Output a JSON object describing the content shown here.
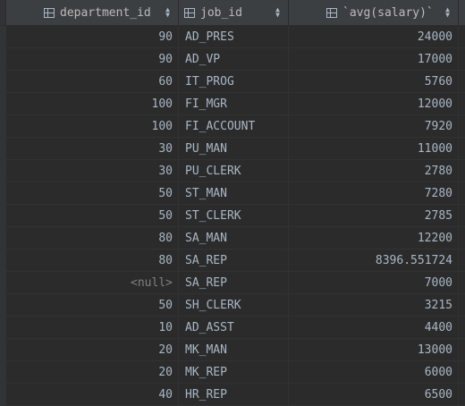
{
  "table": {
    "columns": [
      {
        "label": "department_id",
        "icon": "column-icon"
      },
      {
        "label": "job_id",
        "icon": "column-icon"
      },
      {
        "label": "`avg(salary)`",
        "icon": "column-icon"
      }
    ],
    "rows": [
      {
        "department_id": "90",
        "job_id": "AD_PRES",
        "avg_salary": "24000"
      },
      {
        "department_id": "90",
        "job_id": "AD_VP",
        "avg_salary": "17000"
      },
      {
        "department_id": "60",
        "job_id": "IT_PROG",
        "avg_salary": "5760"
      },
      {
        "department_id": "100",
        "job_id": "FI_MGR",
        "avg_salary": "12000"
      },
      {
        "department_id": "100",
        "job_id": "FI_ACCOUNT",
        "avg_salary": "7920"
      },
      {
        "department_id": "30",
        "job_id": "PU_MAN",
        "avg_salary": "11000"
      },
      {
        "department_id": "30",
        "job_id": "PU_CLERK",
        "avg_salary": "2780"
      },
      {
        "department_id": "50",
        "job_id": "ST_MAN",
        "avg_salary": "7280"
      },
      {
        "department_id": "50",
        "job_id": "ST_CLERK",
        "avg_salary": "2785"
      },
      {
        "department_id": "80",
        "job_id": "SA_MAN",
        "avg_salary": "12200"
      },
      {
        "department_id": "80",
        "job_id": "SA_REP",
        "avg_salary": "8396.551724"
      },
      {
        "department_id": "<null>",
        "job_id": "SA_REP",
        "avg_salary": "7000"
      },
      {
        "department_id": "50",
        "job_id": "SH_CLERK",
        "avg_salary": "3215"
      },
      {
        "department_id": "10",
        "job_id": "AD_ASST",
        "avg_salary": "4400"
      },
      {
        "department_id": "20",
        "job_id": "MK_MAN",
        "avg_salary": "13000"
      },
      {
        "department_id": "20",
        "job_id": "MK_REP",
        "avg_salary": "6000"
      },
      {
        "department_id": "40",
        "job_id": "HR_REP",
        "avg_salary": "6500"
      }
    ]
  },
  "colors": {
    "background": "#2b2b2b",
    "header": "#3c3f41",
    "text": "#a9b7c6",
    "null_text": "#808080"
  }
}
